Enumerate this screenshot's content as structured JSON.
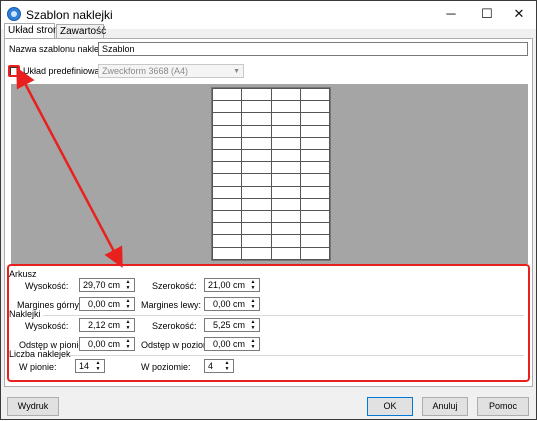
{
  "window": {
    "title": "Szablon naklejki",
    "controls": {
      "minimize": "─",
      "maximize": "☐",
      "close": "✕"
    }
  },
  "tabs": [
    {
      "label": "Układ strony",
      "active": true
    },
    {
      "label": "Zawartość",
      "active": false
    }
  ],
  "form": {
    "name_label": "Nazwa szablonu naklejki:",
    "name_value": "Szablon",
    "predefined_label": "Układ predefiniowany",
    "predefined_checked": false,
    "predefined_combo_value": "Zweckform 3668 (A4)"
  },
  "preview": {
    "rows": 14,
    "cols": 4
  },
  "arkusz": {
    "title": "Arkusz",
    "height_label": "Wysokość:",
    "height_value": "29,70 cm",
    "width_label": "Szerokość:",
    "width_value": "21,00 cm",
    "top_margin_label": "Margines górny:",
    "top_margin_value": "0,00 cm",
    "left_margin_label": "Margines lewy:",
    "left_margin_value": "0,00 cm"
  },
  "naklejki": {
    "title": "Naklejki",
    "height_label": "Wysokość:",
    "height_value": "2,12 cm",
    "width_label": "Szerokość:",
    "width_value": "5,25 cm",
    "vgap_label": "Odstęp w pionie:",
    "vgap_value": "0,00 cm",
    "hgap_label": "Odstęp w poziomie:",
    "hgap_value": "0,00 cm"
  },
  "liczba": {
    "title": "Liczba naklejek",
    "vertical_label": "W pionie:",
    "vertical_value": "14",
    "horizontal_label": "W poziomie:",
    "horizontal_value": "4"
  },
  "buttons": {
    "print": "Wydruk",
    "ok": "OK",
    "cancel": "Anuluj",
    "help": "Pomoc"
  },
  "colors": {
    "annotation": "#e8211e",
    "preview_bg": "#a5a5a5",
    "accent": "#0078d7"
  },
  "icons": {
    "up": "▲",
    "down": "▼",
    "combo": "▼"
  }
}
